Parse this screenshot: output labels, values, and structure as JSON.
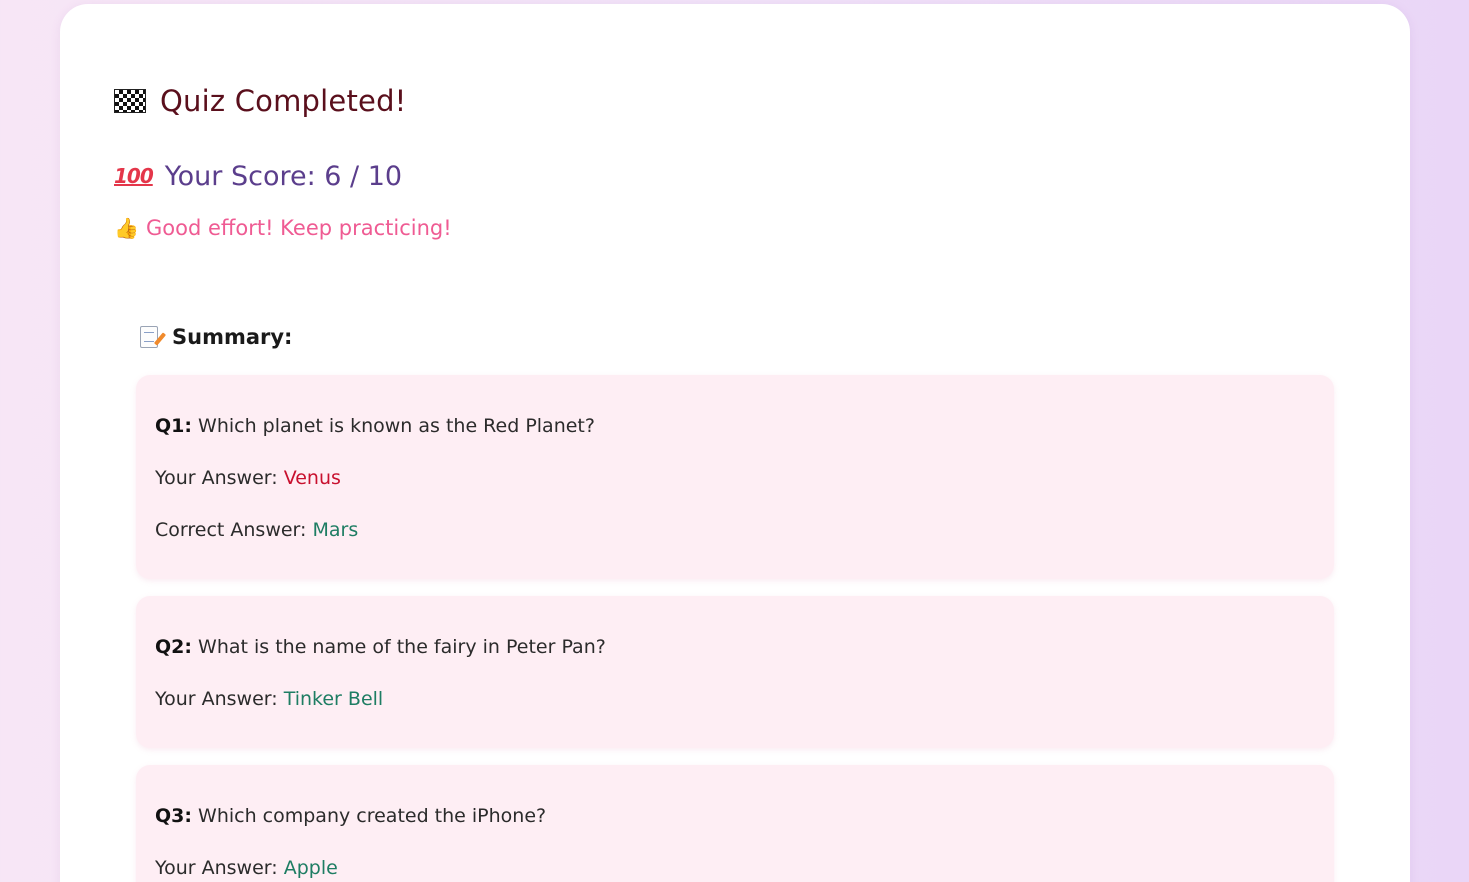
{
  "header": {
    "title": "Quiz Completed!",
    "title_icon": "checkered-flag-icon",
    "score_text": "Your Score: 6 / 10",
    "score_icon": "hundred-points-icon",
    "message": "Good effort! Keep practicing!",
    "message_icon": "thumbs-up-icon"
  },
  "summary": {
    "title": "Summary:",
    "icon": "memo-icon",
    "your_answer_label": "Your Answer:",
    "correct_answer_label": "Correct Answer:",
    "items": [
      {
        "num": "Q1:",
        "question": "Which planet is known as the Red Planet?",
        "your_answer": "Venus",
        "correct_answer": "Mars",
        "is_correct": false
      },
      {
        "num": "Q2:",
        "question": "What is the name of the fairy in Peter Pan?",
        "your_answer": "Tinker Bell",
        "is_correct": true
      },
      {
        "num": "Q3:",
        "question": "Which company created the iPhone?",
        "your_answer": "Apple",
        "is_correct": true
      }
    ]
  },
  "colors": {
    "title": "#5a0f1c",
    "score": "#5b3e8c",
    "message": "#ef5b93",
    "wrong_answer": "#c8102e",
    "correct_answer": "#1e7d63",
    "question_card_bg": "#feeef4"
  }
}
